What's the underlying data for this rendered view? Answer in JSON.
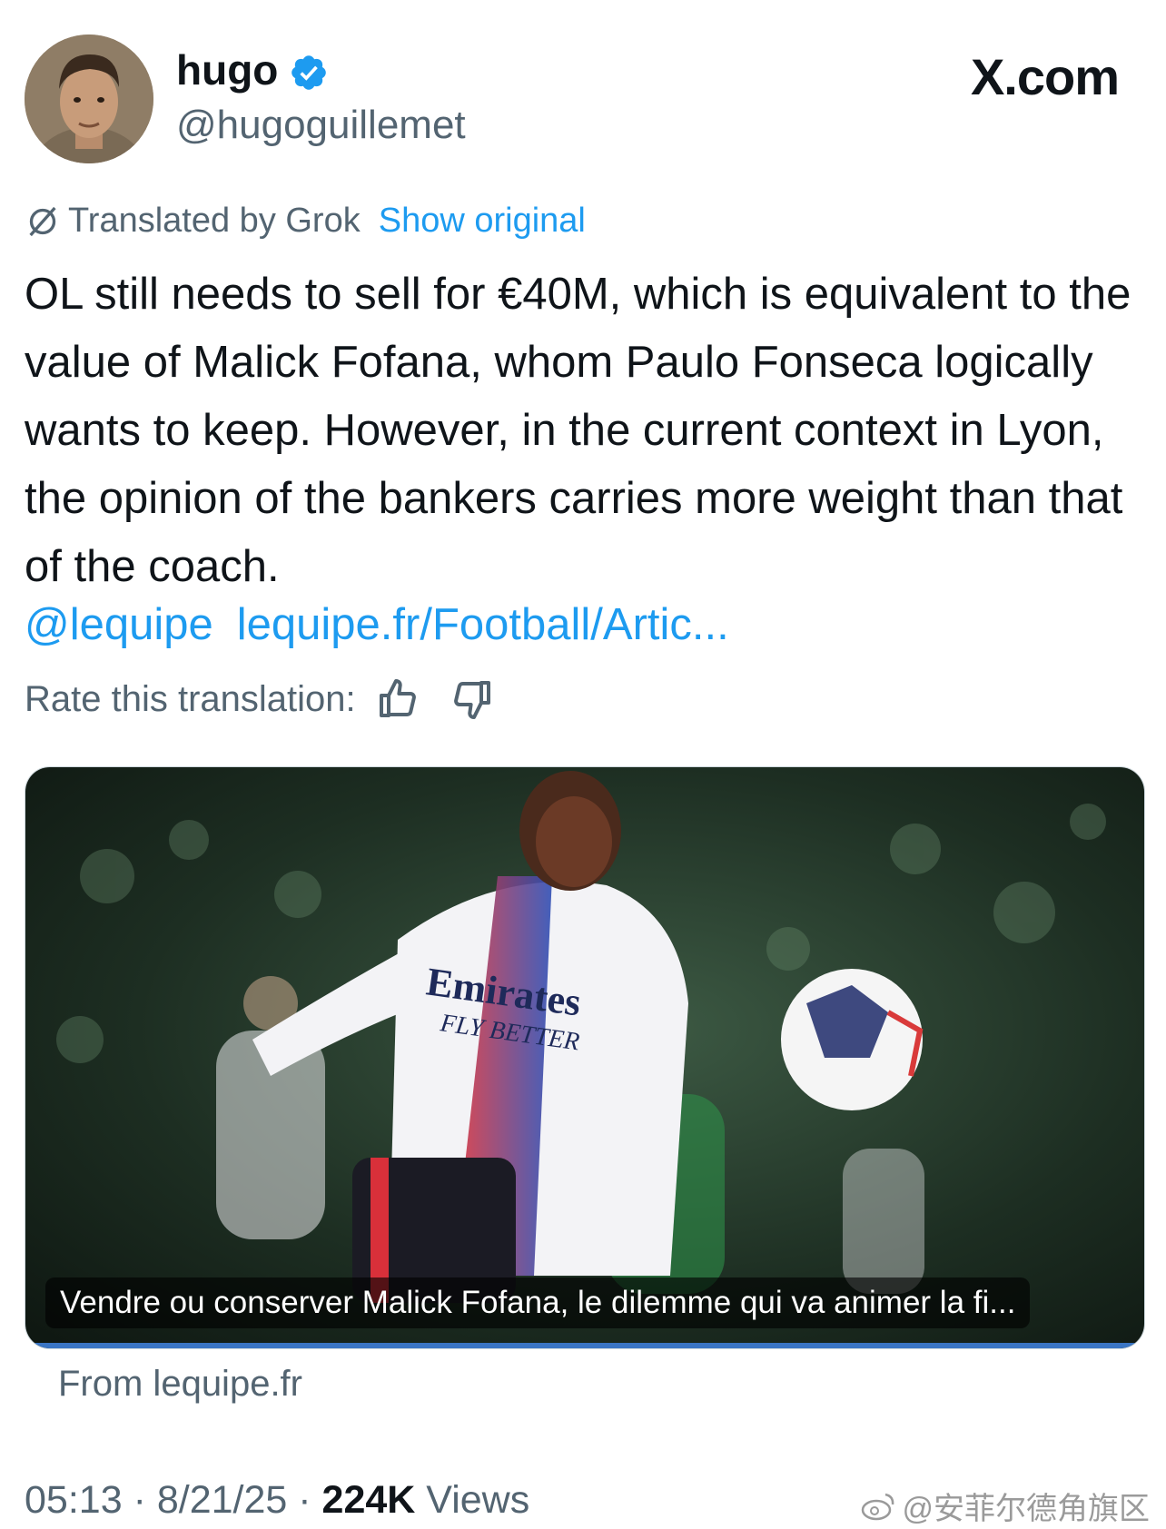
{
  "author": {
    "name": "hugo",
    "handle": "@hugoguillemet"
  },
  "brand": "X.com",
  "translation": {
    "label": "Translated by Grok",
    "show_original": "Show original"
  },
  "tweet": {
    "text": "OL still needs to sell for €40M, which is equivalent to the value of Malick Fofana, whom Paulo Fonseca logically wants to keep. However, in the current context in Lyon, the opinion of the bankers carries more weight than that of the coach.",
    "mention": "@lequipe",
    "link": "lequipe.fr/Football/Artic..."
  },
  "rate": {
    "label": "Rate this translation:"
  },
  "card": {
    "title": "Vendre ou conserver Malick Fofana, le dilemme qui va animer la fi...",
    "source": "From lequipe.fr",
    "shirt_sponsor": "Emirates",
    "shirt_tagline": "FLY BETTER"
  },
  "meta": {
    "time": "05:13",
    "sep1": "·",
    "date": "8/21/25",
    "sep2": "·",
    "views_count": "224K",
    "views_label": "Views"
  },
  "watermark": "@安菲尔德角旗区",
  "colors": {
    "link": "#1d9bf0",
    "verified": "#1d9bf0",
    "muted": "#536471",
    "text": "#0f1419"
  }
}
